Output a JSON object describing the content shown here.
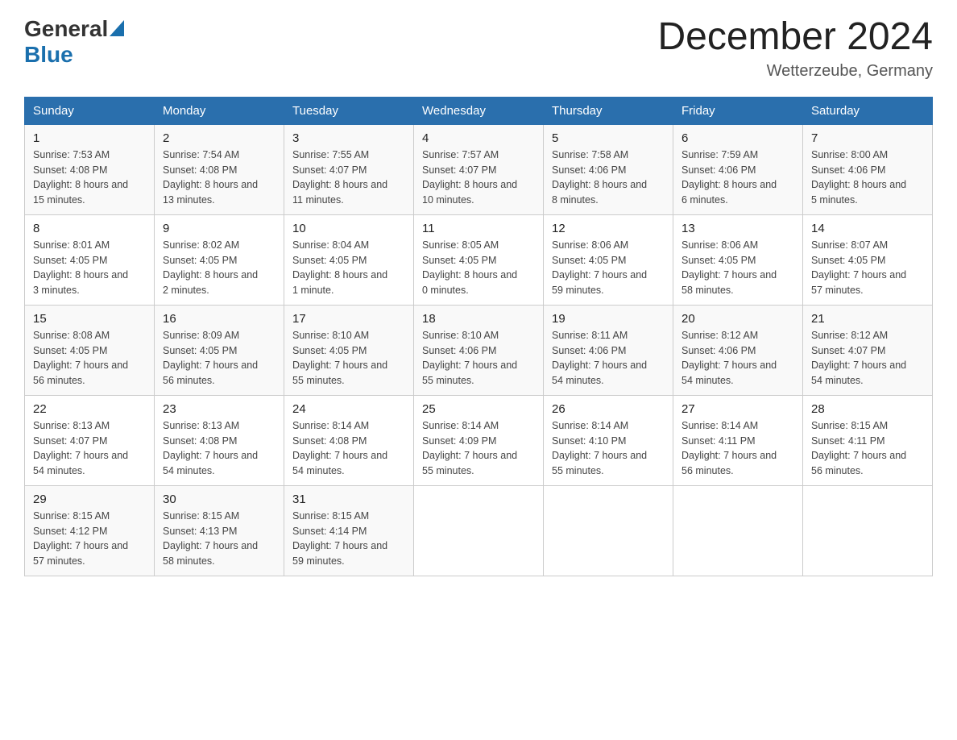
{
  "header": {
    "logo_general": "General",
    "logo_blue": "Blue",
    "month_title": "December 2024",
    "location": "Wetterzeube, Germany"
  },
  "days_of_week": [
    "Sunday",
    "Monday",
    "Tuesday",
    "Wednesday",
    "Thursday",
    "Friday",
    "Saturday"
  ],
  "weeks": [
    [
      {
        "day": "1",
        "sunrise": "7:53 AM",
        "sunset": "4:08 PM",
        "daylight": "8 hours and 15 minutes."
      },
      {
        "day": "2",
        "sunrise": "7:54 AM",
        "sunset": "4:08 PM",
        "daylight": "8 hours and 13 minutes."
      },
      {
        "day": "3",
        "sunrise": "7:55 AM",
        "sunset": "4:07 PM",
        "daylight": "8 hours and 11 minutes."
      },
      {
        "day": "4",
        "sunrise": "7:57 AM",
        "sunset": "4:07 PM",
        "daylight": "8 hours and 10 minutes."
      },
      {
        "day": "5",
        "sunrise": "7:58 AM",
        "sunset": "4:06 PM",
        "daylight": "8 hours and 8 minutes."
      },
      {
        "day": "6",
        "sunrise": "7:59 AM",
        "sunset": "4:06 PM",
        "daylight": "8 hours and 6 minutes."
      },
      {
        "day": "7",
        "sunrise": "8:00 AM",
        "sunset": "4:06 PM",
        "daylight": "8 hours and 5 minutes."
      }
    ],
    [
      {
        "day": "8",
        "sunrise": "8:01 AM",
        "sunset": "4:05 PM",
        "daylight": "8 hours and 3 minutes."
      },
      {
        "day": "9",
        "sunrise": "8:02 AM",
        "sunset": "4:05 PM",
        "daylight": "8 hours and 2 minutes."
      },
      {
        "day": "10",
        "sunrise": "8:04 AM",
        "sunset": "4:05 PM",
        "daylight": "8 hours and 1 minute."
      },
      {
        "day": "11",
        "sunrise": "8:05 AM",
        "sunset": "4:05 PM",
        "daylight": "8 hours and 0 minutes."
      },
      {
        "day": "12",
        "sunrise": "8:06 AM",
        "sunset": "4:05 PM",
        "daylight": "7 hours and 59 minutes."
      },
      {
        "day": "13",
        "sunrise": "8:06 AM",
        "sunset": "4:05 PM",
        "daylight": "7 hours and 58 minutes."
      },
      {
        "day": "14",
        "sunrise": "8:07 AM",
        "sunset": "4:05 PM",
        "daylight": "7 hours and 57 minutes."
      }
    ],
    [
      {
        "day": "15",
        "sunrise": "8:08 AM",
        "sunset": "4:05 PM",
        "daylight": "7 hours and 56 minutes."
      },
      {
        "day": "16",
        "sunrise": "8:09 AM",
        "sunset": "4:05 PM",
        "daylight": "7 hours and 56 minutes."
      },
      {
        "day": "17",
        "sunrise": "8:10 AM",
        "sunset": "4:05 PM",
        "daylight": "7 hours and 55 minutes."
      },
      {
        "day": "18",
        "sunrise": "8:10 AM",
        "sunset": "4:06 PM",
        "daylight": "7 hours and 55 minutes."
      },
      {
        "day": "19",
        "sunrise": "8:11 AM",
        "sunset": "4:06 PM",
        "daylight": "7 hours and 54 minutes."
      },
      {
        "day": "20",
        "sunrise": "8:12 AM",
        "sunset": "4:06 PM",
        "daylight": "7 hours and 54 minutes."
      },
      {
        "day": "21",
        "sunrise": "8:12 AM",
        "sunset": "4:07 PM",
        "daylight": "7 hours and 54 minutes."
      }
    ],
    [
      {
        "day": "22",
        "sunrise": "8:13 AM",
        "sunset": "4:07 PM",
        "daylight": "7 hours and 54 minutes."
      },
      {
        "day": "23",
        "sunrise": "8:13 AM",
        "sunset": "4:08 PM",
        "daylight": "7 hours and 54 minutes."
      },
      {
        "day": "24",
        "sunrise": "8:14 AM",
        "sunset": "4:08 PM",
        "daylight": "7 hours and 54 minutes."
      },
      {
        "day": "25",
        "sunrise": "8:14 AM",
        "sunset": "4:09 PM",
        "daylight": "7 hours and 55 minutes."
      },
      {
        "day": "26",
        "sunrise": "8:14 AM",
        "sunset": "4:10 PM",
        "daylight": "7 hours and 55 minutes."
      },
      {
        "day": "27",
        "sunrise": "8:14 AM",
        "sunset": "4:11 PM",
        "daylight": "7 hours and 56 minutes."
      },
      {
        "day": "28",
        "sunrise": "8:15 AM",
        "sunset": "4:11 PM",
        "daylight": "7 hours and 56 minutes."
      }
    ],
    [
      {
        "day": "29",
        "sunrise": "8:15 AM",
        "sunset": "4:12 PM",
        "daylight": "7 hours and 57 minutes."
      },
      {
        "day": "30",
        "sunrise": "8:15 AM",
        "sunset": "4:13 PM",
        "daylight": "7 hours and 58 minutes."
      },
      {
        "day": "31",
        "sunrise": "8:15 AM",
        "sunset": "4:14 PM",
        "daylight": "7 hours and 59 minutes."
      },
      null,
      null,
      null,
      null
    ]
  ],
  "labels": {
    "sunrise": "Sunrise:",
    "sunset": "Sunset:",
    "daylight": "Daylight:"
  }
}
